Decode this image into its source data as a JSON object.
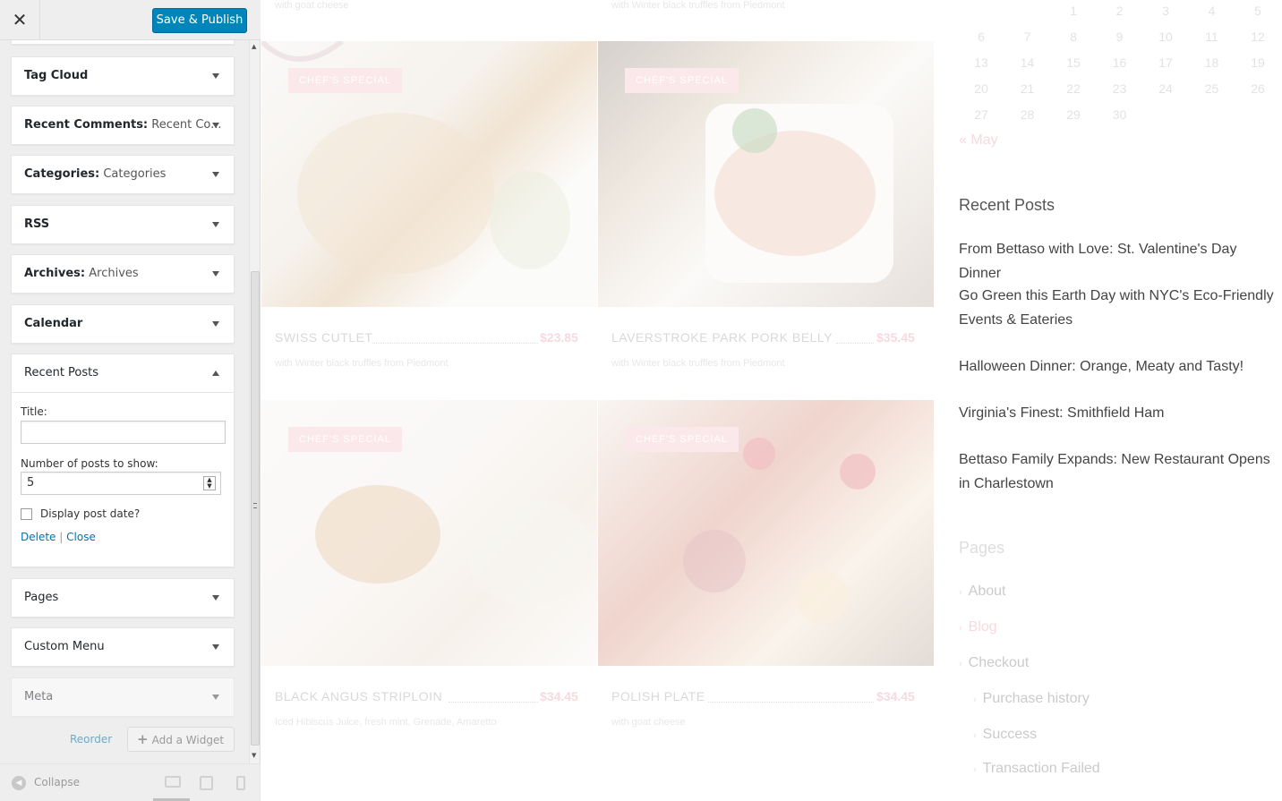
{
  "topbar": {
    "close_icon": "close-icon",
    "publish_label": "Save & Publish"
  },
  "widgets": {
    "tag_cloud": "Tag Cloud",
    "recent_comments": {
      "name": "Recent Comments:",
      "sub": "Recent Co..."
    },
    "categories": {
      "name": "Categories:",
      "sub": "Categories"
    },
    "rss": "RSS",
    "archives": {
      "name": "Archives:",
      "sub": "Archives"
    },
    "calendar": "Calendar",
    "recent_posts": {
      "name": "Recent Posts",
      "title_label": "Title:",
      "title_value": "",
      "number_label": "Number of posts to show:",
      "number_value": "5",
      "date_label": "Display post date?",
      "delete": "Delete",
      "sep": "|",
      "close": "Close"
    },
    "pages": "Pages",
    "custom_menu": "Custom Menu",
    "meta": "Meta"
  },
  "actions": {
    "reorder": "Reorder",
    "add_widget": "Add a Widget"
  },
  "footer": {
    "collapse": "Collapse"
  },
  "preview": {
    "top_descs": [
      "with goat cheese",
      "with Winter black truffles from Piedmont"
    ],
    "badge": "CHEF'S SPECIAL",
    "items": [
      {
        "name": "SWISS CUTLET",
        "price": "$23.85",
        "desc": "with Winter black truffles from Piedmont"
      },
      {
        "name": "LAVERSTROKE PARK PORK BELLY",
        "price": "$35.45",
        "desc": "with Winter black truffles from Piedmont"
      },
      {
        "name": "BLACK ANGUS STRIPLOIN",
        "price": "$34.45",
        "desc": "Iced Hibiscus Juice, fresh mint, Grenade, Amaretto"
      },
      {
        "name": "POLISH PLATE",
        "price": "$34.45",
        "desc": "with goat cheese"
      }
    ],
    "calendar": [
      [
        "1",
        "2",
        "3",
        "4",
        "5"
      ],
      [
        "6",
        "7",
        "8",
        "9",
        "10",
        "11",
        "12"
      ],
      [
        "13",
        "14",
        "15",
        "16",
        "17",
        "18",
        "19"
      ],
      [
        "20",
        "21",
        "22",
        "23",
        "24",
        "25",
        "26"
      ],
      [
        "27",
        "28",
        "29",
        "30"
      ]
    ],
    "prev_month": "« May",
    "recent_posts_title": "Recent Posts",
    "recent_posts": [
      "From Bettaso with Love: St. Valentine's Day Dinner",
      "Go Green this Earth Day with NYC's Eco-Friendly Events & Eateries",
      "Halloween Dinner: Orange, Meaty and Tasty!",
      "Virginia's Finest: Smithfield Ham",
      "Bettaso Family Expands: New Restaurant Opens in Charlestown"
    ],
    "pages_title": "Pages",
    "pages": [
      "About",
      "Blog",
      "Checkout",
      "Purchase history",
      "Success",
      "Transaction Failed"
    ]
  }
}
